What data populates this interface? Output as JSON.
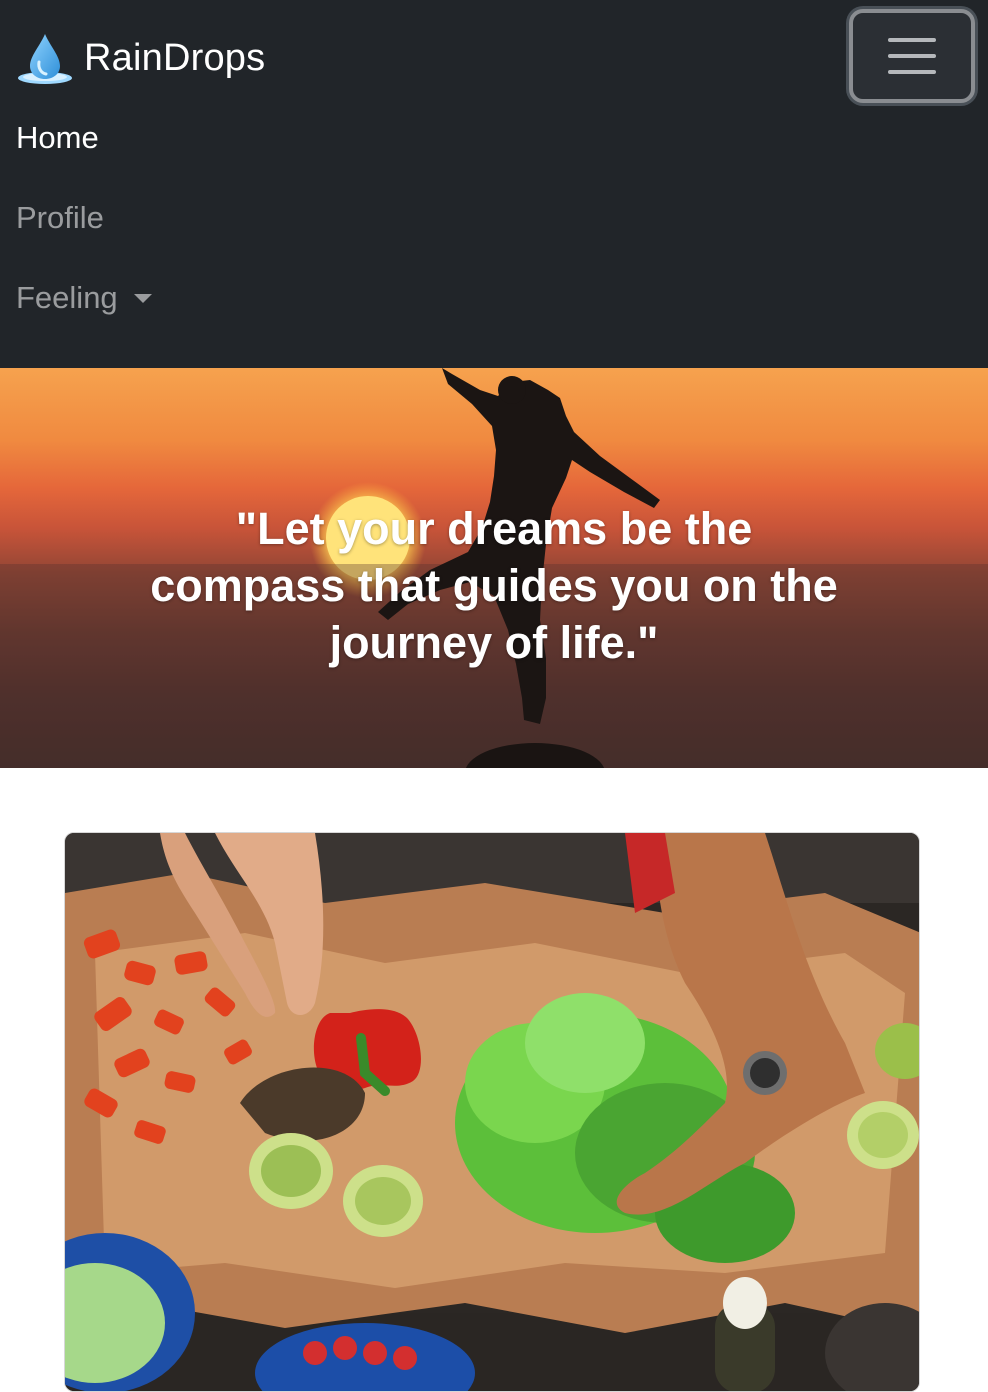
{
  "navbar": {
    "brand": {
      "name": "RainDrops",
      "icon": "water-drop-icon"
    },
    "toggler_icon": "hamburger-menu-icon",
    "links": [
      {
        "label": "Home",
        "active": true
      },
      {
        "label": "Profile",
        "active": false
      },
      {
        "label": "Feeling",
        "active": false,
        "dropdown": true
      }
    ]
  },
  "hero": {
    "quote": "\"Let your dreams be the compass that guides you on the journey of life.\""
  },
  "colors": {
    "navbar_bg": "#212529",
    "nav_active": "#ffffff",
    "nav_inactive": "rgba(255,255,255,0.55)",
    "brand_drop": "#4aa8e8"
  }
}
